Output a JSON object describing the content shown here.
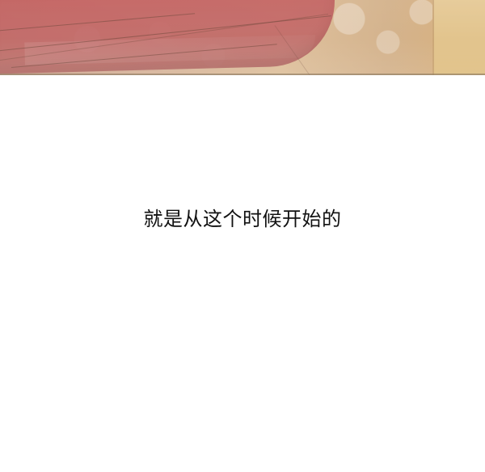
{
  "caption": {
    "text": "就是从这个时候开始的"
  },
  "colors": {
    "background": "#ffffff",
    "caption": "#111111",
    "illustration_pink": "#c36a69",
    "illustration_gold": "#dec09c",
    "illustration_right_panel": "#dfbf83"
  }
}
